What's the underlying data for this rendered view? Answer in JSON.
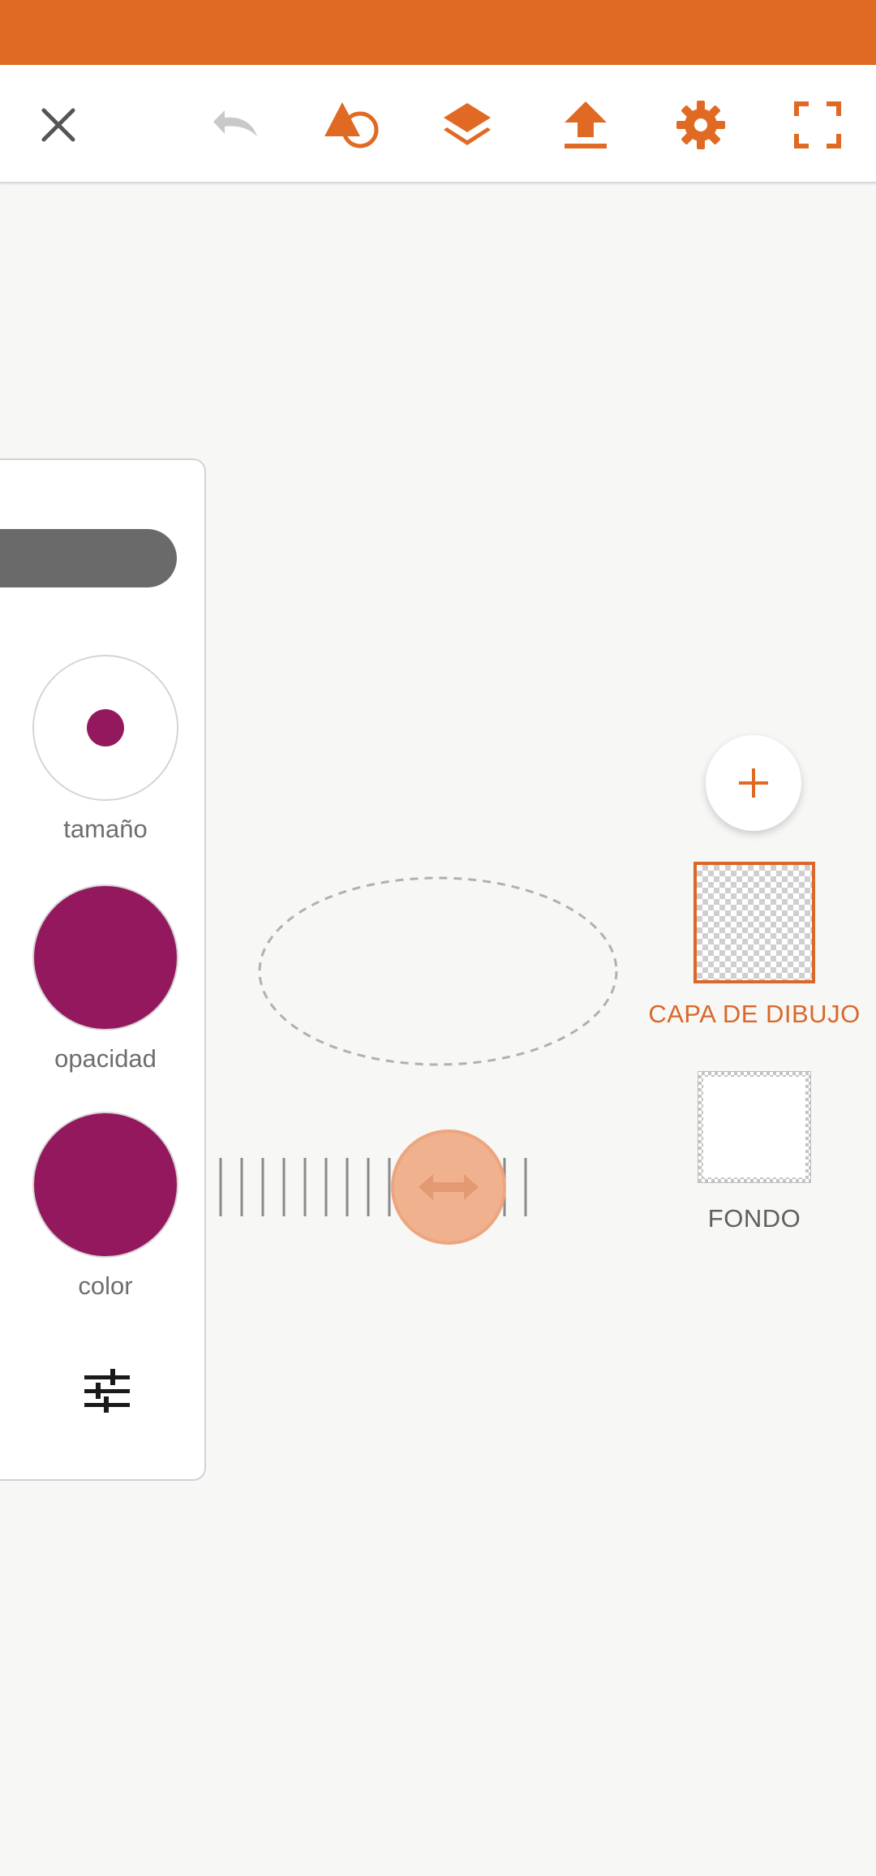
{
  "colors": {
    "accent": "#e06a23",
    "brush_color": "#94185d",
    "toolbar_bg": "#ffffff",
    "canvas_bg": "#f7f7f5"
  },
  "toolbar": {
    "close_icon": "close-icon",
    "undo_icon": "undo-icon",
    "shapes_icon": "shape-tool-icon",
    "layers_icon": "layers-icon",
    "export_icon": "upload-icon",
    "settings_icon": "gear-icon",
    "fullscreen_icon": "fullscreen-icon"
  },
  "brush_panel": {
    "size_label": "tamaño",
    "opacity_label": "opacidad",
    "color_label": "color",
    "settings_icon": "sliders-icon"
  },
  "layers": {
    "add_icon": "plus-icon",
    "items": [
      {
        "label": "CAPA DE DIBUJO",
        "selected": true
      },
      {
        "label": "FONDO",
        "selected": false
      }
    ]
  }
}
